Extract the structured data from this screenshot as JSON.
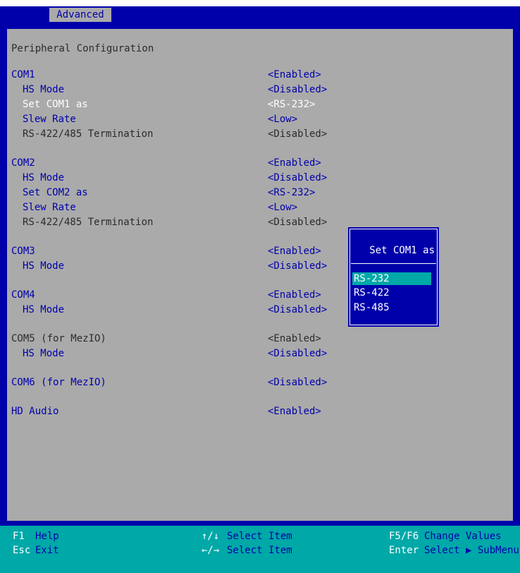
{
  "tab": "Advanced",
  "section_title": "Peripheral Configuration",
  "settings": [
    {
      "label": "COM1",
      "value": "<Enabled>"
    },
    {
      "label": "HS Mode",
      "value": "<Disabled>"
    },
    {
      "label": "Set COM1 as",
      "value": "<RS-232>"
    },
    {
      "label": "Slew Rate",
      "value": "<Low>"
    },
    {
      "label": "RS-422/485 Termination",
      "value": "<Disabled>"
    },
    {
      "label": "COM2",
      "value": "<Enabled>"
    },
    {
      "label": "HS Mode",
      "value": "<Disabled>"
    },
    {
      "label": "Set COM2 as",
      "value": "<RS-232>"
    },
    {
      "label": "Slew Rate",
      "value": "<Low>"
    },
    {
      "label": "RS-422/485 Termination",
      "value": "<Disabled>"
    },
    {
      "label": "COM3",
      "value": "<Enabled>"
    },
    {
      "label": "HS Mode",
      "value": "<Disabled>"
    },
    {
      "label": "COM4",
      "value": "<Enabled>"
    },
    {
      "label": "HS Mode",
      "value": "<Disabled>"
    },
    {
      "label": "COM5 (for MezIO)",
      "value": "<Enabled>"
    },
    {
      "label": "HS Mode",
      "value": "<Disabled>"
    },
    {
      "label": "COM6 (for MezIO)",
      "value": "<Disabled>"
    },
    {
      "label": "HD Audio",
      "value": "<Enabled>"
    }
  ],
  "popup": {
    "title": "Set COM1 as",
    "options": [
      "RS-232",
      "RS-422",
      "RS-485"
    ],
    "selected": "RS-232"
  },
  "footer": {
    "f1_key": "F1",
    "f1_desc": "Help",
    "esc_key": "Esc",
    "esc_desc": "Exit",
    "updown_key": "↑/↓",
    "updown_desc": "Select Item",
    "leftright_key": "←/→",
    "leftright_desc": "Select Item",
    "f5f6_key": "F5/F6",
    "f5f6_desc": "Change Values",
    "enter_key": "Enter",
    "enter_desc": "Select ▶ SubMenu"
  },
  "colors": {
    "frame": "#0000aa",
    "panel": "#aaaaaa",
    "highlight": "#00a8a8",
    "text_blue": "#0000aa",
    "text_white": "#ffffff"
  }
}
